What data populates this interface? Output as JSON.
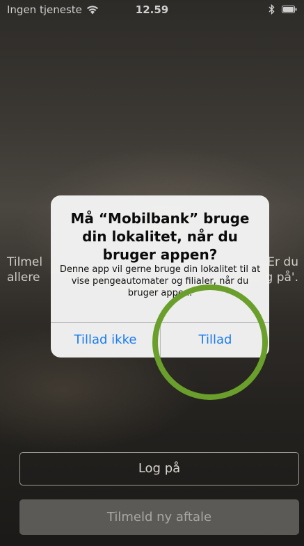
{
  "status_bar": {
    "carrier": "Ingen tjeneste",
    "time": "12.59",
    "wifi_icon": "wifi-icon",
    "bluetooth_icon": "bluetooth-icon",
    "battery_icon": "battery-icon"
  },
  "background": {
    "left_lines": [
      "Tilmel",
      "allere"
    ],
    "right_lines": [
      "Er du",
      "g på'."
    ]
  },
  "alert": {
    "title": "Må “Mobilbank” bruge din lokalitet, når du bruger appen?",
    "message": "Denne app vil gerne bruge din lokalitet til at vise pengeautomater og filialer, når du bruger appen.",
    "deny_label": "Tillad ikke",
    "allow_label": "Tillad"
  },
  "buttons": {
    "login_label": "Log på",
    "register_label": "Tilmeld ny aftale"
  },
  "colors": {
    "accent": "#1a7cf0",
    "highlight": "#6a9f2c"
  }
}
